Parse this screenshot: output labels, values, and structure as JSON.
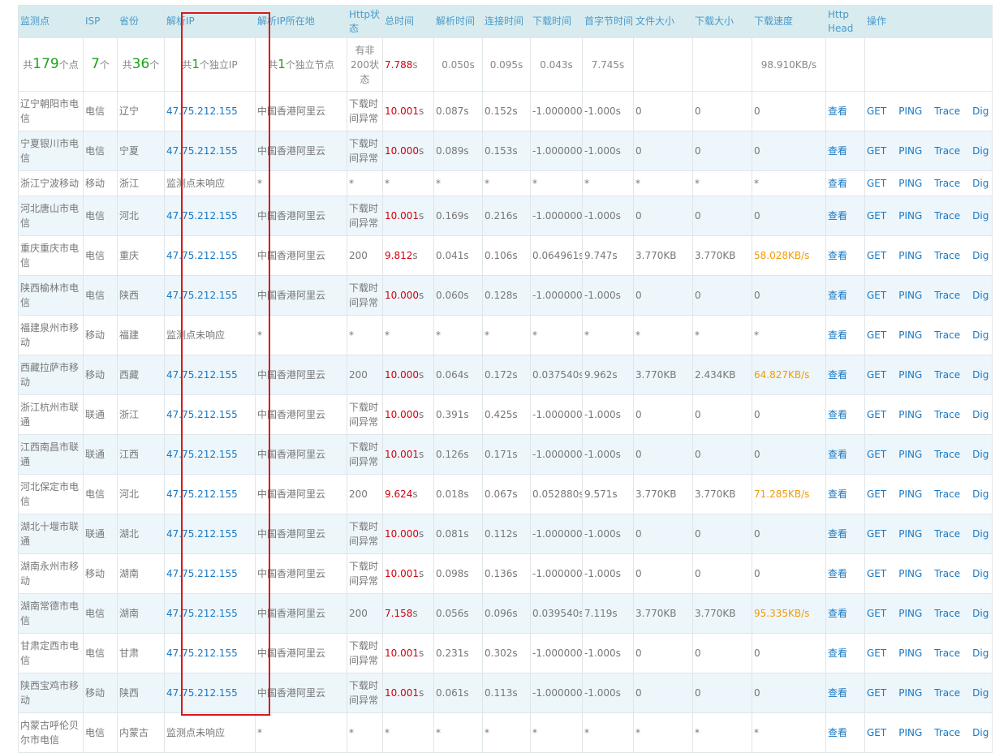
{
  "columns": [
    "监测点",
    "ISP",
    "省份",
    "解析IP",
    "解析IP所在地",
    "Http状态",
    "总时间",
    "解析时间",
    "连接时间",
    "下载时间",
    "首字节时间",
    "文件大小",
    "下载大小",
    "下载速度",
    "Http Head",
    "操作"
  ],
  "summary": {
    "points_prefix": "共",
    "points_count": "179",
    "points_suffix": "个点",
    "isp_count": "7",
    "isp_suffix": "个",
    "prov_prefix": "共",
    "prov_count": "36",
    "prov_suffix": "个",
    "ip_prefix": "共",
    "ip_count": "1",
    "ip_suffix": "个独立IP",
    "node_prefix": "共",
    "node_count": "1",
    "node_suffix": "个独立节点",
    "http": "有非200状态",
    "total_num": "7.788",
    "total_unit": "s",
    "dns": "0.050s",
    "conn": "0.095s",
    "dl": "0.043s",
    "first": "7.745s",
    "speed": "98.910KB/s"
  },
  "ops": [
    "GET",
    "PING",
    "Trace",
    "Dig"
  ],
  "view_label": "查看",
  "rows": [
    {
      "point": "辽宁朝阳市电信",
      "isp": "电信",
      "prov": "辽宁",
      "ip": "47.75.212.155",
      "loc": "中国香港阿里云",
      "http": "下载时间异常",
      "total_num": "10.001",
      "total_unit": "s",
      "dns": "0.087s",
      "conn": "0.152s",
      "dl": "-1.000000s",
      "first": "-1.000s",
      "fsize": "0",
      "dsize": "0",
      "speed": "0"
    },
    {
      "point": "宁夏银川市电信",
      "isp": "电信",
      "prov": "宁夏",
      "ip": "47.75.212.155",
      "loc": "中国香港阿里云",
      "http": "下载时间异常",
      "total_num": "10.000",
      "total_unit": "s",
      "dns": "0.089s",
      "conn": "0.153s",
      "dl": "-1.000000s",
      "first": "-1.000s",
      "fsize": "0",
      "dsize": "0",
      "speed": "0"
    },
    {
      "point": "浙江宁波移动",
      "isp": "移动",
      "prov": "浙江",
      "ip": "监测点未响应",
      "loc": "*",
      "http": "*",
      "total_num": "*",
      "total_unit": "",
      "dns": "*",
      "conn": "*",
      "dl": "*",
      "first": "*",
      "fsize": "*",
      "dsize": "*",
      "speed": "*"
    },
    {
      "point": "河北唐山市电信",
      "isp": "电信",
      "prov": "河北",
      "ip": "47.75.212.155",
      "loc": "中国香港阿里云",
      "http": "下载时间异常",
      "total_num": "10.001",
      "total_unit": "s",
      "dns": "0.169s",
      "conn": "0.216s",
      "dl": "-1.000000s",
      "first": "-1.000s",
      "fsize": "0",
      "dsize": "0",
      "speed": "0"
    },
    {
      "point": "重庆重庆市电信",
      "isp": "电信",
      "prov": "重庆",
      "ip": "47.75.212.155",
      "loc": "中国香港阿里云",
      "http": "200",
      "total_num": "9.812",
      "total_unit": "s",
      "dns": "0.041s",
      "conn": "0.106s",
      "dl": "0.064961s",
      "first": "9.747s",
      "fsize": "3.770KB",
      "dsize": "3.770KB",
      "speed": "58.028KB/s"
    },
    {
      "point": "陕西榆林市电信",
      "isp": "电信",
      "prov": "陕西",
      "ip": "47.75.212.155",
      "loc": "中国香港阿里云",
      "http": "下载时间异常",
      "total_num": "10.000",
      "total_unit": "s",
      "dns": "0.060s",
      "conn": "0.128s",
      "dl": "-1.000000s",
      "first": "-1.000s",
      "fsize": "0",
      "dsize": "0",
      "speed": "0"
    },
    {
      "point": "福建泉州市移动",
      "isp": "移动",
      "prov": "福建",
      "ip": "监测点未响应",
      "loc": "*",
      "http": "*",
      "total_num": "*",
      "total_unit": "",
      "dns": "*",
      "conn": "*",
      "dl": "*",
      "first": "*",
      "fsize": "*",
      "dsize": "*",
      "speed": "*"
    },
    {
      "point": "西藏拉萨市移动",
      "isp": "移动",
      "prov": "西藏",
      "ip": "47.75.212.155",
      "loc": "中国香港阿里云",
      "http": "200",
      "total_num": "10.000",
      "total_unit": "s",
      "dns": "0.064s",
      "conn": "0.172s",
      "dl": "0.037540s",
      "first": "9.962s",
      "fsize": "3.770KB",
      "dsize": "2.434KB",
      "speed": "64.827KB/s"
    },
    {
      "point": "浙江杭州市联通",
      "isp": "联通",
      "prov": "浙江",
      "ip": "47.75.212.155",
      "loc": "中国香港阿里云",
      "http": "下载时间异常",
      "total_num": "10.000",
      "total_unit": "s",
      "dns": "0.391s",
      "conn": "0.425s",
      "dl": "-1.000000s",
      "first": "-1.000s",
      "fsize": "0",
      "dsize": "0",
      "speed": "0"
    },
    {
      "point": "江西南昌市联通",
      "isp": "联通",
      "prov": "江西",
      "ip": "47.75.212.155",
      "loc": "中国香港阿里云",
      "http": "下载时间异常",
      "total_num": "10.001",
      "total_unit": "s",
      "dns": "0.126s",
      "conn": "0.171s",
      "dl": "-1.000000s",
      "first": "-1.000s",
      "fsize": "0",
      "dsize": "0",
      "speed": "0"
    },
    {
      "point": "河北保定市电信",
      "isp": "电信",
      "prov": "河北",
      "ip": "47.75.212.155",
      "loc": "中国香港阿里云",
      "http": "200",
      "total_num": "9.624",
      "total_unit": "s",
      "dns": "0.018s",
      "conn": "0.067s",
      "dl": "0.052880s",
      "first": "9.571s",
      "fsize": "3.770KB",
      "dsize": "3.770KB",
      "speed": "71.285KB/s"
    },
    {
      "point": "湖北十堰市联通",
      "isp": "联通",
      "prov": "湖北",
      "ip": "47.75.212.155",
      "loc": "中国香港阿里云",
      "http": "下载时间异常",
      "total_num": "10.000",
      "total_unit": "s",
      "dns": "0.081s",
      "conn": "0.112s",
      "dl": "-1.000000s",
      "first": "-1.000s",
      "fsize": "0",
      "dsize": "0",
      "speed": "0"
    },
    {
      "point": "湖南永州市移动",
      "isp": "移动",
      "prov": "湖南",
      "ip": "47.75.212.155",
      "loc": "中国香港阿里云",
      "http": "下载时间异常",
      "total_num": "10.001",
      "total_unit": "s",
      "dns": "0.098s",
      "conn": "0.136s",
      "dl": "-1.000000s",
      "first": "-1.000s",
      "fsize": "0",
      "dsize": "0",
      "speed": "0"
    },
    {
      "point": "湖南常德市电信",
      "isp": "电信",
      "prov": "湖南",
      "ip": "47.75.212.155",
      "loc": "中国香港阿里云",
      "http": "200",
      "total_num": "7.158",
      "total_unit": "s",
      "dns": "0.056s",
      "conn": "0.096s",
      "dl": "0.039540s",
      "first": "7.119s",
      "fsize": "3.770KB",
      "dsize": "3.770KB",
      "speed": "95.335KB/s"
    },
    {
      "point": "甘肃定西市电信",
      "isp": "电信",
      "prov": "甘肃",
      "ip": "47.75.212.155",
      "loc": "中国香港阿里云",
      "http": "下载时间异常",
      "total_num": "10.001",
      "total_unit": "s",
      "dns": "0.231s",
      "conn": "0.302s",
      "dl": "-1.000000s",
      "first": "-1.000s",
      "fsize": "0",
      "dsize": "0",
      "speed": "0"
    },
    {
      "point": "陕西宝鸡市移动",
      "isp": "移动",
      "prov": "陕西",
      "ip": "47.75.212.155",
      "loc": "中国香港阿里云",
      "http": "下载时间异常",
      "total_num": "10.001",
      "total_unit": "s",
      "dns": "0.061s",
      "conn": "0.113s",
      "dl": "-1.000000s",
      "first": "-1.000s",
      "fsize": "0",
      "dsize": "0",
      "speed": "0"
    },
    {
      "point": "内蒙古呼伦贝尔市电信",
      "isp": "电信",
      "prov": "内蒙古",
      "ip": "监测点未响应",
      "loc": "*",
      "http": "*",
      "total_num": "*",
      "total_unit": "",
      "dns": "*",
      "conn": "*",
      "dl": "*",
      "first": "*",
      "fsize": "*",
      "dsize": "*",
      "speed": "*"
    }
  ],
  "colors": {
    "header_bg": "#d8ecef",
    "header_text": "#4a9acb",
    "link": "#1a78c2",
    "total_time": "#d4000d",
    "speed": "#f39a00",
    "count": "#1aa31a",
    "highlight_border": "#d9161a",
    "stripe": "#edf6fb"
  }
}
